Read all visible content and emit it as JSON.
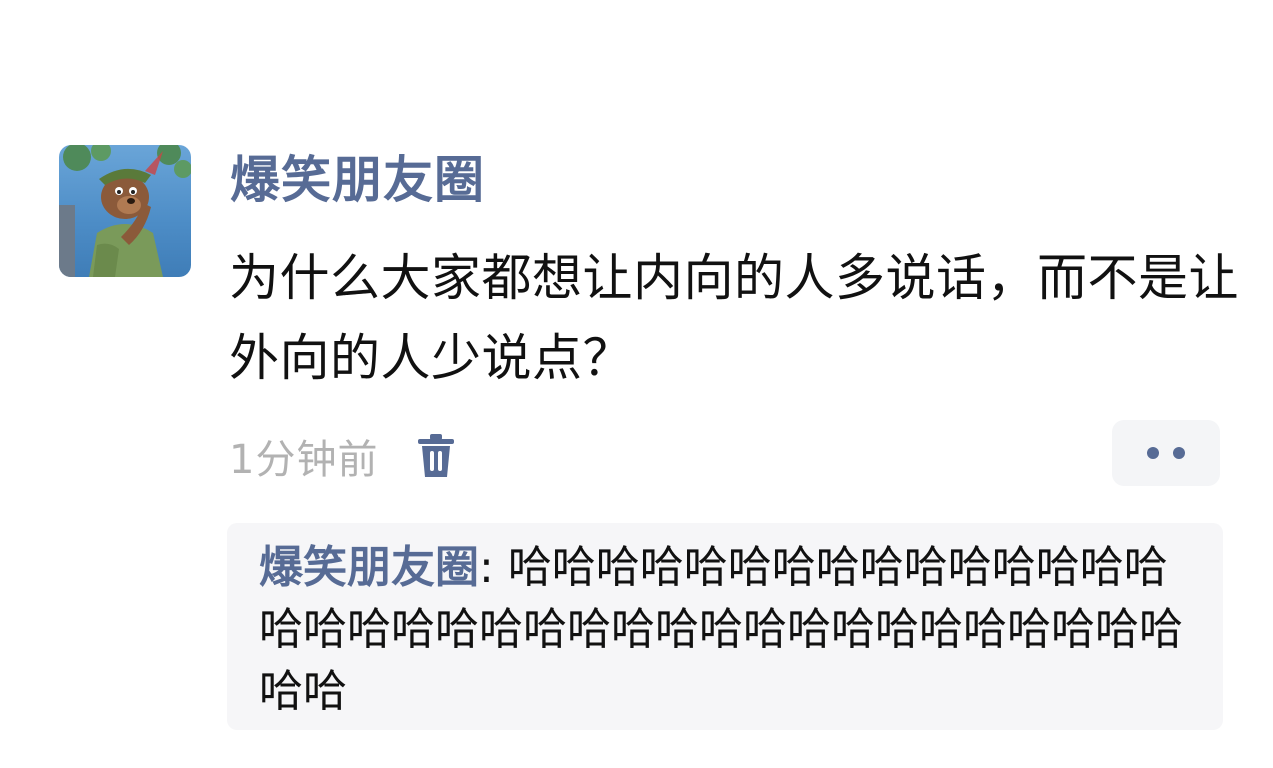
{
  "post": {
    "username": "爆笑朋友圈",
    "text": "为什么大家都想让内向的人多说话，而不是让外向的人少说点？",
    "timestamp": "1分钟前"
  },
  "icons": {
    "delete": "trash-icon",
    "more": "more-dots-icon",
    "avatar": "bear-cartoon-avatar"
  },
  "comment": {
    "author": "爆笑朋友圈",
    "separator": ": ",
    "text": "哈哈哈哈哈哈哈哈哈哈哈哈哈哈哈哈哈哈哈哈哈哈哈哈哈哈哈哈哈哈哈哈哈哈哈哈哈哈"
  },
  "colors": {
    "link": "#576b95",
    "timestamp": "#b2b2b2",
    "comment_bg": "#f6f6f8"
  }
}
